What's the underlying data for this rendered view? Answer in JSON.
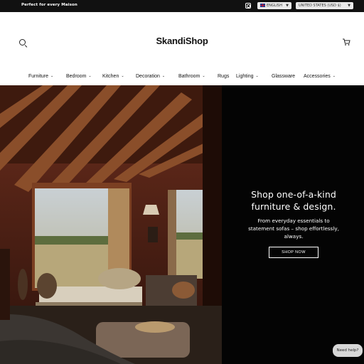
{
  "topbar": {
    "promo": "Perfect for every Maison",
    "language": "ENGLISH",
    "country": "UNITED STATES (USD $)"
  },
  "header": {
    "logo": "SkandiShop"
  },
  "nav": {
    "items": [
      {
        "label": "Furniture",
        "dropdown": true
      },
      {
        "label": "Bedroom",
        "dropdown": true
      },
      {
        "label": "Kitchen",
        "dropdown": true
      },
      {
        "label": "Decoration",
        "dropdown": true
      },
      {
        "label": "Bathroom",
        "dropdown": true
      },
      {
        "label": "Rugs",
        "dropdown": false
      },
      {
        "label": "Lighting",
        "dropdown": true
      },
      {
        "label": "Glassware",
        "dropdown": false
      },
      {
        "label": "Accessories",
        "dropdown": true
      }
    ]
  },
  "hero": {
    "title_line1": "Shop one-of-a-kind",
    "title_line2": "furniture & design.",
    "sub_line1": "From everyday essentials to",
    "sub_line2": "statement sofas – shop effortlessly,",
    "sub_line3": "always.",
    "cta": "SHOP NOW"
  },
  "help": {
    "label": "Need help?"
  },
  "icons": {
    "instagram": "instagram-icon",
    "search": "search-icon",
    "cart": "cart-icon",
    "chevron": "chevron-down-icon"
  },
  "colors": {
    "topbar_bg": "#111111",
    "hero_bg": "#040404",
    "help_bg": "#d7d7d7"
  }
}
